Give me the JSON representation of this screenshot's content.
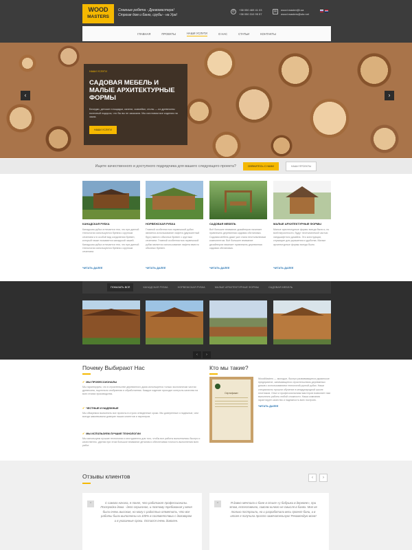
{
  "header": {
    "logo_line1": "WOOD",
    "logo_line2": "MASTERS",
    "slogan_line1": "Славные ребята - Древомастера!",
    "slogan_line2": "Строим дом и баню, срубы - на Ура!",
    "phone1": "+38 050 469 41 03",
    "phone2": "+38 050 310 95 57",
    "email1": "wood.master@i.ua",
    "email2": "wood.masters@ukr.net",
    "phone_icon": "phone-icon",
    "mail_icon": "mail-icon"
  },
  "nav": [
    "Главная",
    "Проекты",
    "Наши услуги",
    "О нас",
    "Статьи",
    "Контакты"
  ],
  "hero": {
    "tag": "Наши услуги",
    "title": "Садовая мебель и малые архитектурные формы",
    "text": "Беседки, детские площадки, качели, скамейки, столы — из древесины полезный подарок, что бы вы не заказали. Мы изготовим все изделия на заказ.",
    "button": "Наши услуги",
    "prev": "‹",
    "next": "›"
  },
  "cta": {
    "question": "Ищете качественного и доступного подрядчика для вашего следующего проекта?",
    "contact": "Свяжитесь с нами",
    "projects": "Наши проекты"
  },
  "services": [
    {
      "title": "Канадская рубка",
      "text": "Канадская рубка отличается тем, что при данной технологии используются бревна с круглым сечением и в особой вид соединения бревен, который также называется канадской чашей. Канадская рубка отличается тем, что при данной технологии используются бревна с круглым сечением.",
      "more": "Читать далее"
    },
    {
      "title": "Норвежская рубка",
      "text": "Главной особенностью норвежской рубки является использование лафета (двухкантный брус) вместо обычных бревен с круглым сечением. Главной особенностью норвежской рубки является использование лафета вместо обычных бревен.",
      "more": "Читать далее"
    },
    {
      "title": "Садовая мебель",
      "text": "Всё большее внимание дизайнеров начинает привлекать деревянная садовая обстановка. Садовая мебель даже уже стала неотъемлемым компонентом. Всё большее внимание дизайнеров начинает привлекать деревянная садовая обстановка.",
      "more": "Читать далее"
    },
    {
      "title": "Малые архитектурные формы",
      "text": "Малые архитектурные формы всегда были и, по всей вероятности, будут неотъемлемой частью ландшафтного дизайна. Это конструкции, служащие для украшения и удобства. Малые архитектурные формы всегда были.",
      "more": "Читать далее"
    }
  ],
  "portfolio": {
    "tabs": [
      "Показать всё",
      "Канадская рубка",
      "Норвежская рубка",
      "Малые архитектурные формы",
      "Садовая мебель"
    ],
    "prev": "‹",
    "next": "›"
  },
  "why": {
    "title": "Почему Выбирают Нас",
    "items": [
      {
        "title": "Мы профессионалы",
        "text": "Мы гарантируем, что в строительстве деревянного дома используется только экологически чистая древесина, тщательно отобранная и обработанная. Каждое изделие проходит контроль качества на всех этапах производства."
      },
      {
        "title": "Честные и надежные",
        "text": "Мы обязуемся выполнить все проекты в строго отведенные сроки. Мы доверенные и надежные, чем всегда завоевывали доверие наших клиентов и партнеров."
      },
      {
        "title": "Мы используем лучшие технологии",
        "text": "Мы используем лучшие технологии и инструменты для того, чтобы все работы выполнялись быстро и качественно, уделяя при этом большое внимание деталям и обеспечивая точность выполнения всех работ."
      }
    ]
  },
  "about": {
    "title": "Кто мы такие?",
    "text": "WoodMasters — молодое, быстро развивающееся украинское предприятие, занимающееся строительством деревянных домов с использованием технологий ручной рубки. Наши специалисты прошли обучение в международной школе плотников. Опыт и профессионализм мастеров позволяет нам выполнять работы любой сложности. Наша компания гарантирует качество и надежность всех построек.",
    "more": "Читать далее",
    "cert_title": "Сертификат"
  },
  "reviews": {
    "title": "Отзывы клиентов",
    "quote_icon": "quote-icon",
    "items": [
      "С самого начала, я понял, что работают профессионалы. Постройка дома - дело серьезное, и поэтому требования у меня были очень высокие, но могу с радостью отметить, что все работы были выполнены на 100% в соответствии с договором и в указанные сроки. Остался очень доволен.",
      "Я давно мечтала о бане в стиле «у бабушки в деревне», при этом, естественно, совсем ничего не смысля в банях. Мне не только построили, но и разработали весь проект бани, и в итоге я получила просто замечательную! Рекомендую всем!"
    ],
    "prev": "‹",
    "next": "›"
  },
  "colors": {
    "accent": "#f5b800",
    "dark": "#3c3c3c",
    "link": "#2a76b3"
  }
}
